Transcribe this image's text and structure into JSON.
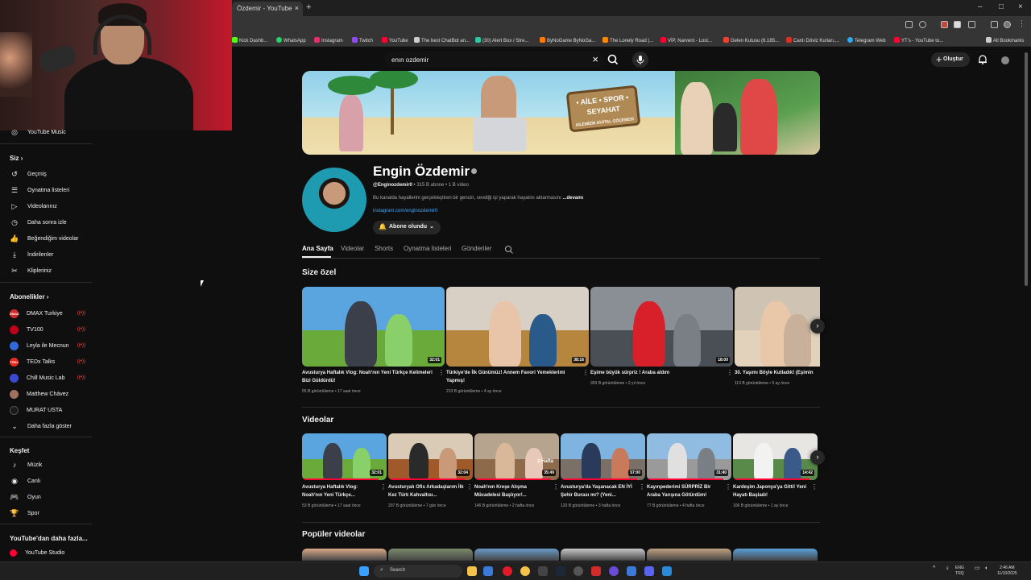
{
  "browser": {
    "tab_title": "Özdemir - YouTube",
    "tab_close": "×",
    "new_tab": "+",
    "window_controls": [
      "–",
      "□",
      "×"
    ],
    "bookmarks": [
      {
        "label": "Kick Dashb...",
        "color": "#53fc18"
      },
      {
        "label": "WhatsApp",
        "color": "#25d366"
      },
      {
        "label": "Instagram",
        "color": "#e1306c"
      },
      {
        "label": "Twitch",
        "color": "#9146ff"
      },
      {
        "label": "YouTube",
        "color": "#ff0033"
      },
      {
        "label": "The best ChatBot an...",
        "color": "#cccccc"
      },
      {
        "label": "(30) Alert Box / Stre...",
        "color": "#31c3a2"
      },
      {
        "label": "ByNoGame ByNoGa...",
        "color": "#ff7a00"
      },
      {
        "label": "The Lonely Road |...",
        "color": "#ff8a00"
      },
      {
        "label": "VİP, Narvent - Lost...",
        "color": "#ff0033"
      },
      {
        "label": "Gelen Kutusu (6.185...",
        "color": "#ea4335"
      },
      {
        "label": "Canlı Döviz Kurları,...",
        "color": "#d93025"
      },
      {
        "label": "Telegram Web",
        "color": "#2aabee"
      },
      {
        "label": "YT's - YouTube to...",
        "color": "#ff0033"
      }
    ],
    "all_bookmarks": "All Bookmarks"
  },
  "header": {
    "search_value": "enın ozdemir",
    "search_clear": "×",
    "create_label": "Oluştur",
    "create_plus": "+"
  },
  "sidebar": {
    "top_item": "YouTube Music",
    "you_heading": "Siz",
    "you_items": [
      {
        "label": "Geçmiş",
        "icon": "↺"
      },
      {
        "label": "Oynatma listeleri",
        "icon": "☰"
      },
      {
        "label": "Videolarınız",
        "icon": "▷"
      },
      {
        "label": "Daha sonra izle",
        "icon": "◷"
      },
      {
        "label": "Beğendiğim videolar",
        "icon": "👍"
      },
      {
        "label": "İndirilenler",
        "icon": "⤓"
      },
      {
        "label": "Klipleriniz",
        "icon": "✂"
      }
    ],
    "subs_heading": "Abonelikler",
    "subscriptions": [
      {
        "label": "DMAX Turkiye",
        "color": "#d22b2b",
        "abbr": "DMAX"
      },
      {
        "label": "TV100",
        "color": "#c0001a",
        "abbr": ""
      },
      {
        "label": "Leyla ile Mecnun",
        "color": "#2f6ad8",
        "abbr": ""
      },
      {
        "label": "TEDx Talks",
        "color": "#e62b1e",
        "abbr": "TEDx"
      },
      {
        "label": "Chill Music Lab",
        "color": "#3b4ad0",
        "abbr": ""
      },
      {
        "label": "Matthew Chávez",
        "color": "#a07060",
        "abbr": ""
      },
      {
        "label": "MURAT USTA",
        "color": "#1a1a1a",
        "abbr": ""
      }
    ],
    "live_marker": "((•))",
    "show_more": "Daha fazla göster",
    "explore_heading": "Keşfet",
    "explore_items": [
      {
        "label": "Müzik",
        "icon": "♪"
      },
      {
        "label": "Canlı",
        "icon": "◉"
      },
      {
        "label": "Oyun",
        "icon": "🎮"
      },
      {
        "label": "Spor",
        "icon": "🏆"
      }
    ],
    "more_heading": "YouTube'dan daha fazla...",
    "studio": "YouTube Studio"
  },
  "banner": {
    "sign_text": "• AİLE • SPOR • SEYAHAT",
    "sign_sub": "AİLEMİZİN DİJİTAL GÖÇEBESİ"
  },
  "channel": {
    "name": "Engin Özdemir",
    "handle": "@Enginozdemir0",
    "subs": "315 B abone",
    "videos": "1 B video",
    "separator": "•",
    "description": "Bu kanalda hayallerini gerçekleştiren bir gencin, sevdiği işi yaparak hayatını aktarmasını",
    "more": "...devamı",
    "link": "instagram.com/enginozdemir0",
    "subscribe_label": "Abone olundu",
    "subscribe_chevron": "⌄",
    "tabs": [
      "Ana Sayfa",
      "Videolar",
      "Shorts",
      "Oynatma listeleri",
      "Gönderiler"
    ]
  },
  "for_you": {
    "title": "Size özel",
    "videos": [
      {
        "title": "Avusturya Haftalık Vlog: Noah'nın Yeni Türkçe Kelimeleri Bizi Güldürdü!",
        "duration": "32:01",
        "views": "55 B görüntüleme",
        "age": "17 saat önce",
        "sky": "#5aa4e0",
        "ground": "#6aaa3a",
        "progress": 0
      },
      {
        "title": "Türkiye'de İlk Günümüz! Annem Favori Yemeklerimi Yapmış!",
        "duration": "38:16",
        "views": "213 B görüntüleme",
        "age": "4 ay önce",
        "sky": "#d8d0c4",
        "ground": "#b7863e",
        "progress": 0
      },
      {
        "title": "Eşime büyük sürpriz ! Araba aldım",
        "duration": "18:00",
        "views": "303 B görüntüleme",
        "age": "2 yıl önce",
        "sky": "#8a8f96",
        "ground": "#4a4e55",
        "progress": 0
      },
      {
        "title": "30. Yaşımı Böyle Kutladık! (Eşimin",
        "duration": "",
        "views": "113 B görüntüleme",
        "age": "5 ay önce",
        "sky": "#cfc4b4",
        "ground": "#e2d2bc",
        "progress": 0
      }
    ]
  },
  "videos_section": {
    "title": "Videolar",
    "videos": [
      {
        "title": "Avusturya Haftalık Vlog: Noah'nın Yeni Türkçe...",
        "duration": "32:01",
        "views": "53 B görüntüleme",
        "age": "17 saat önce",
        "sky": "#5aa4e0",
        "ground": "#6aaa3a",
        "progress": 0.9
      },
      {
        "title": "Avusturyalı Ofis Arkadaşlarım İlk Kez Türk Kahvaltısı...",
        "duration": "32:04",
        "views": "207 B görüntüleme",
        "age": "7 gün önce",
        "sky": "#d9cbb6",
        "ground": "#a05a2a",
        "progress": 0.9
      },
      {
        "title": "Noah'nın Kreşe Alışma Mücadelesi Başlıyor!...",
        "duration": "35:49",
        "views": "146 B görüntüleme",
        "age": "2 hafta önce",
        "sky": "#b6a48e",
        "ground": "#8c6a4a",
        "progress": 0.9
      },
      {
        "title": "Avusturya'da Yaşanacak EN İYİ Şehir Burası mı? (Yeni...",
        "duration": "57:00",
        "views": "120 B görüntüleme",
        "age": "3 hafta önce",
        "sky": "#7fb4e0",
        "ground": "#7a7068",
        "progress": 0.9
      },
      {
        "title": "Kayınpederimi SÜRPRİZ Bir Araba Yarışına Götürdüm!",
        "duration": "31:40",
        "views": "77 B görüntüleme",
        "age": "4 hafta önce",
        "sky": "#8fbce0",
        "ground": "#9a9a9a",
        "progress": 0.9
      },
      {
        "title": "Kardeşim Japonya'ya Gitti! Yeni Hayatı Başladı!",
        "duration": "14:42",
        "views": "106 B görüntüleme",
        "age": "1 ay önce",
        "sky": "#e8e6e2",
        "ground": "#5a8a4a",
        "progress": 0.9
      }
    ],
    "thumb_badge": "2.Hafta"
  },
  "popular": {
    "title": "Popüler videolar"
  },
  "taskbar": {
    "search_label": "Search",
    "lang_1": "ENG",
    "lang_2": "TRQ",
    "time": "2:46 AM",
    "date": "11/10/2025"
  },
  "colors": {
    "accent": "#ff0033",
    "link": "#3ea6ff",
    "bg": "#0f0f0f"
  }
}
